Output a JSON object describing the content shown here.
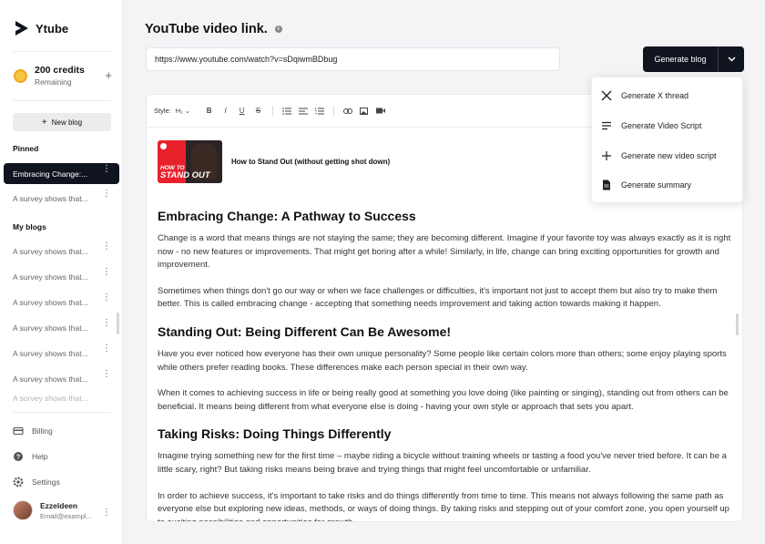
{
  "app": {
    "name": "Ytube"
  },
  "credits": {
    "amount": "200 credits",
    "status": "Remaining",
    "add_symbol": "+"
  },
  "sidebar": {
    "new_blog": "New blog",
    "pinned_heading": "Pinned",
    "pinned": [
      {
        "label": "Embracing Change:..."
      },
      {
        "label": "A survey shows that..."
      }
    ],
    "blogs_heading": "My blogs",
    "blogs": [
      {
        "label": "A survey shows that..."
      },
      {
        "label": "A survey shows that..."
      },
      {
        "label": "A survey shows that..."
      },
      {
        "label": "A survey shows that..."
      },
      {
        "label": "A survey shows that..."
      },
      {
        "label": "A survey shows that..."
      }
    ],
    "bottom": {
      "billing": "Billing",
      "help": "Help",
      "settings": "Settings"
    },
    "user": {
      "name": "Ezzeldeen",
      "email": "Email@exampl..."
    }
  },
  "main": {
    "title": "YouTube video link.",
    "url_value": "https://www.youtube.com/watch?v=sDqiwmBDbug",
    "generate_button": "Generate blog",
    "dropdown": [
      {
        "label": "Generate X thread",
        "icon": "x-logo-icon"
      },
      {
        "label": "Generate Video Script",
        "icon": "lines-icon"
      },
      {
        "label": "Generate new video script",
        "icon": "plus-icon"
      },
      {
        "label": "Generate summary",
        "icon": "document-icon"
      }
    ],
    "toolbar": {
      "style_label": "Style:",
      "style_value": "H₁"
    },
    "video": {
      "title": "How to Stand Out (without getting shot down)",
      "thumb_line1": "HOW TO",
      "thumb_line2": "STAND OUT"
    },
    "article": {
      "h1": "Embracing Change: A Pathway to Success",
      "p1": "Change is a word that means things are not staying the same; they are becoming different. Imagine if your favorite toy was always exactly as it is right now - no new features or improvements. That might get boring after a while! Similarly, in life, change can bring exciting opportunities for growth and improvement.",
      "p2": "Sometimes when things don't go our way or when we face challenges or difficulties, it's important not just to accept them but also try to make them better. This is called embracing change - accepting that something needs improvement and taking action towards making it happen.",
      "h2": "Standing Out: Being Different Can Be Awesome!",
      "p3": "Have you ever noticed how everyone has their own unique personality? Some people like certain colors more than others; some enjoy playing sports while others prefer reading books. These differences make each person special in their own way.",
      "p4": "When it comes to achieving success in life or being really good at something you love doing (like painting or singing), standing out from others can be beneficial. It means being different from what everyone else is doing - having your own style or approach that sets you apart.",
      "h3": "Taking Risks: Doing Things Differently",
      "p5": "Imagine trying something new for the first time – maybe riding a bicycle without training wheels or tasting a food you've never tried before. It can be a little scary, right? But taking risks means being brave and trying things that might feel uncomfortable or unfamiliar.",
      "p6": "In order to achieve success, it's important to take risks and do things differently from time to time. This means not always following the same path as everyone else but exploring new ideas, methods, or ways of doing things. By taking risks and stepping out of your comfort zone, you open yourself up to exciting possibilities and opportunities for growth."
    }
  },
  "colors": {
    "primary_dark": "#10141f",
    "accent_coin": "#f5c542",
    "thumb_red": "#e8212b"
  }
}
